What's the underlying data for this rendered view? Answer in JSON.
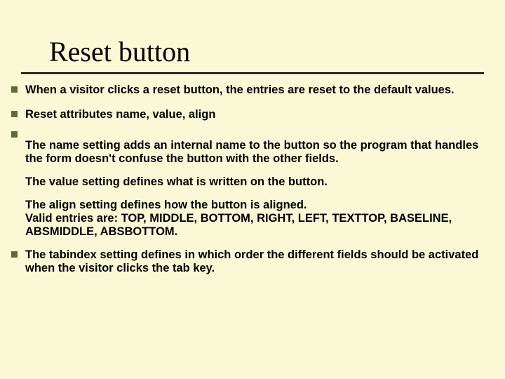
{
  "title": "Reset button",
  "bullets": {
    "b1": "When a visitor clicks a reset button, the entries are reset to the default values.",
    "b2": "Reset attributes  name,  value,   align",
    "b4": "The tabindex setting defines in which order the different fields should be activated when the visitor clicks the tab key."
  },
  "paras": {
    "p1": "The name setting adds an internal name to the button so the program that handles the form doesn't confuse the button with the other fields.",
    "p2": "The value setting defines what is written on the button.",
    "p3a": "The align setting defines how the button is aligned.",
    "p3b": "Valid entries are: TOP, MIDDLE, BOTTOM, RIGHT, LEFT, TEXTTOP, BASELINE, ABSMIDDLE, ABSBOTTOM."
  }
}
